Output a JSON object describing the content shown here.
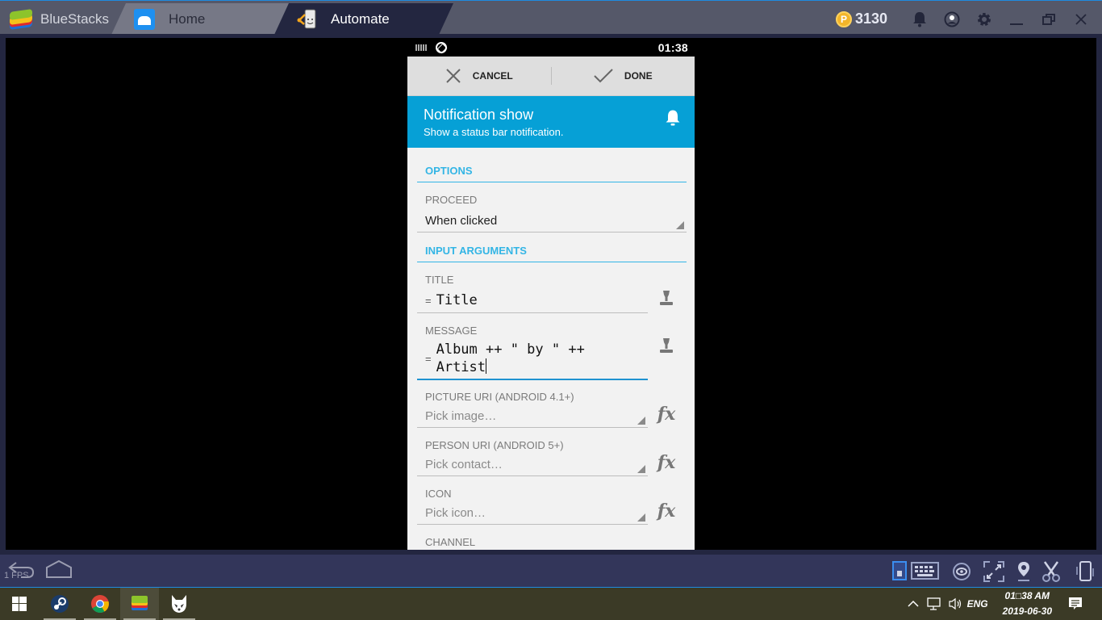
{
  "window": {
    "app_name": "BlueStacks",
    "tabs": [
      {
        "label": "Home",
        "icon": "home-icon"
      },
      {
        "label": "Automate",
        "icon": "automate-app-icon",
        "active": true
      }
    ],
    "coins": "3130",
    "coin_symbol": "P",
    "controls": [
      "bell-icon",
      "account-icon",
      "settings-gear-icon",
      "minimize-icon",
      "restore-icon",
      "close-icon"
    ]
  },
  "android": {
    "status_bar": {
      "time": "01:38",
      "icons": [
        "keyboard-icon",
        "rotation-icon"
      ]
    },
    "action_bar": {
      "cancel_label": "CANCEL",
      "done_label": "DONE"
    },
    "header": {
      "title": "Notification show",
      "subtitle": "Show a status bar notification.",
      "icon": "bell-icon",
      "accent_color": "#06a0d6"
    },
    "sections": {
      "options": "OPTIONS",
      "input_arguments": "INPUT ARGUMENTS"
    },
    "proceed": {
      "label": "PROCEED",
      "value": "When clicked"
    },
    "fields": {
      "title": {
        "label": "TITLE",
        "prefix": "=",
        "value": "Title"
      },
      "message": {
        "label": "MESSAGE",
        "prefix": "=",
        "line1": "Album ++ \" by \" ++",
        "line2": "Artist"
      },
      "picture_uri": {
        "label": "PICTURE URI (ANDROID 4.1+)",
        "placeholder": "Pick image…"
      },
      "person_uri": {
        "label": "PERSON URI (ANDROID 5+)",
        "placeholder": "Pick contact…"
      },
      "icon": {
        "label": "ICON",
        "placeholder": "Pick icon…"
      },
      "channel": {
        "label": "CHANNEL"
      }
    },
    "fx_label": "fx"
  },
  "emulator_toolbar": {
    "fps": "1 FPS",
    "left": [
      "back-icon",
      "home-icon"
    ],
    "right": [
      "toggle-icon",
      "keyboard-icon",
      "eye-icon",
      "fullscreen-icon",
      "location-icon",
      "scissors-icon",
      "rotate-device-icon"
    ]
  },
  "taskbar": {
    "apps": [
      "start-icon",
      "steam-icon",
      "chrome-icon",
      "bluestacks-icon",
      "fox-app-icon"
    ],
    "language": "ENG",
    "time": "01□38 AM",
    "date": "2019-06-30"
  }
}
